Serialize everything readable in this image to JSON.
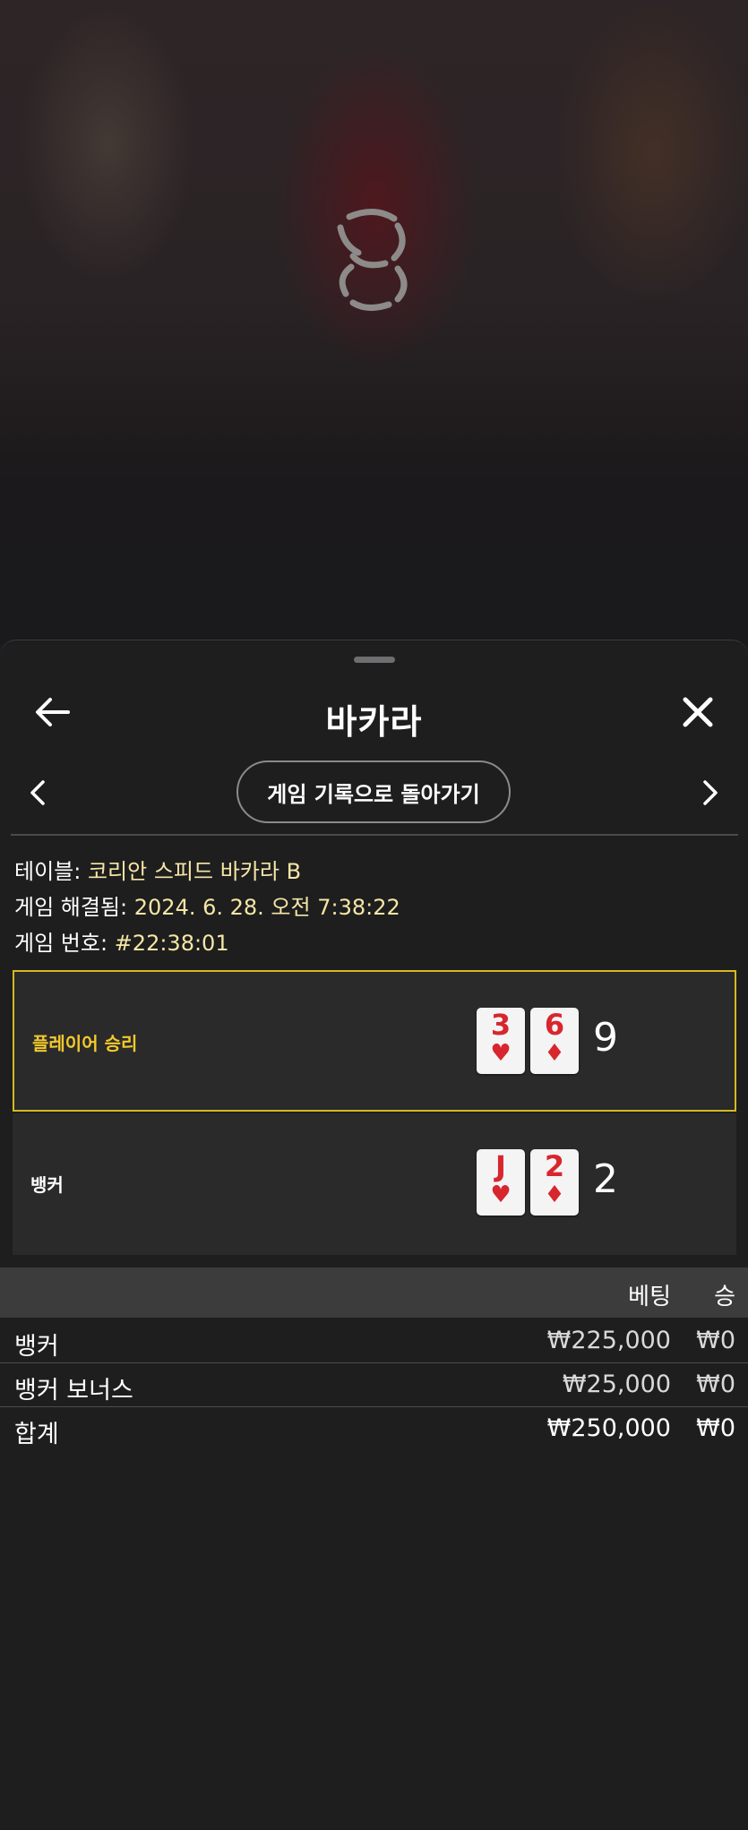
{
  "sheet": {
    "title": "바카라",
    "history_button": "게임 기록으로 돌아가기"
  },
  "info": {
    "table_label": "테이블:",
    "table_value": "코리안 스피드 바카라 B",
    "resolved_label": "게임 해결됨:",
    "resolved_value": "2024. 6. 28. 오전 7:38:22",
    "game_no_label": "게임 번호:",
    "game_no_value": "#22:38:01"
  },
  "hands": [
    {
      "label": "플레이어 승리",
      "winner": true,
      "cards": [
        {
          "rank": "3",
          "suit": "♥"
        },
        {
          "rank": "6",
          "suit": "♦"
        }
      ],
      "score": "9"
    },
    {
      "label": "뱅커",
      "winner": false,
      "cards": [
        {
          "rank": "J",
          "suit": "♥"
        },
        {
          "rank": "2",
          "suit": "♦"
        }
      ],
      "score": "2"
    }
  ],
  "bets": {
    "headers": {
      "bet": "베팅",
      "win": "승"
    },
    "rows": [
      {
        "name": "뱅커",
        "bet": "₩225,000",
        "win": "₩0"
      },
      {
        "name": "뱅커 보너스",
        "bet": "₩25,000",
        "win": "₩0"
      }
    ],
    "total": {
      "name": "합계",
      "bet": "₩250,000",
      "win": "₩0"
    }
  },
  "colors": {
    "win_border": "#d6b91f",
    "win_label": "#f2c92c",
    "info_value": "#f6e6a6",
    "card_red": "#d8262e"
  },
  "icons": {
    "back": "arrow-left-icon",
    "close": "close-icon",
    "prev": "chevron-left-icon",
    "next": "chevron-right-icon",
    "loader": "loading-spinner-icon"
  }
}
